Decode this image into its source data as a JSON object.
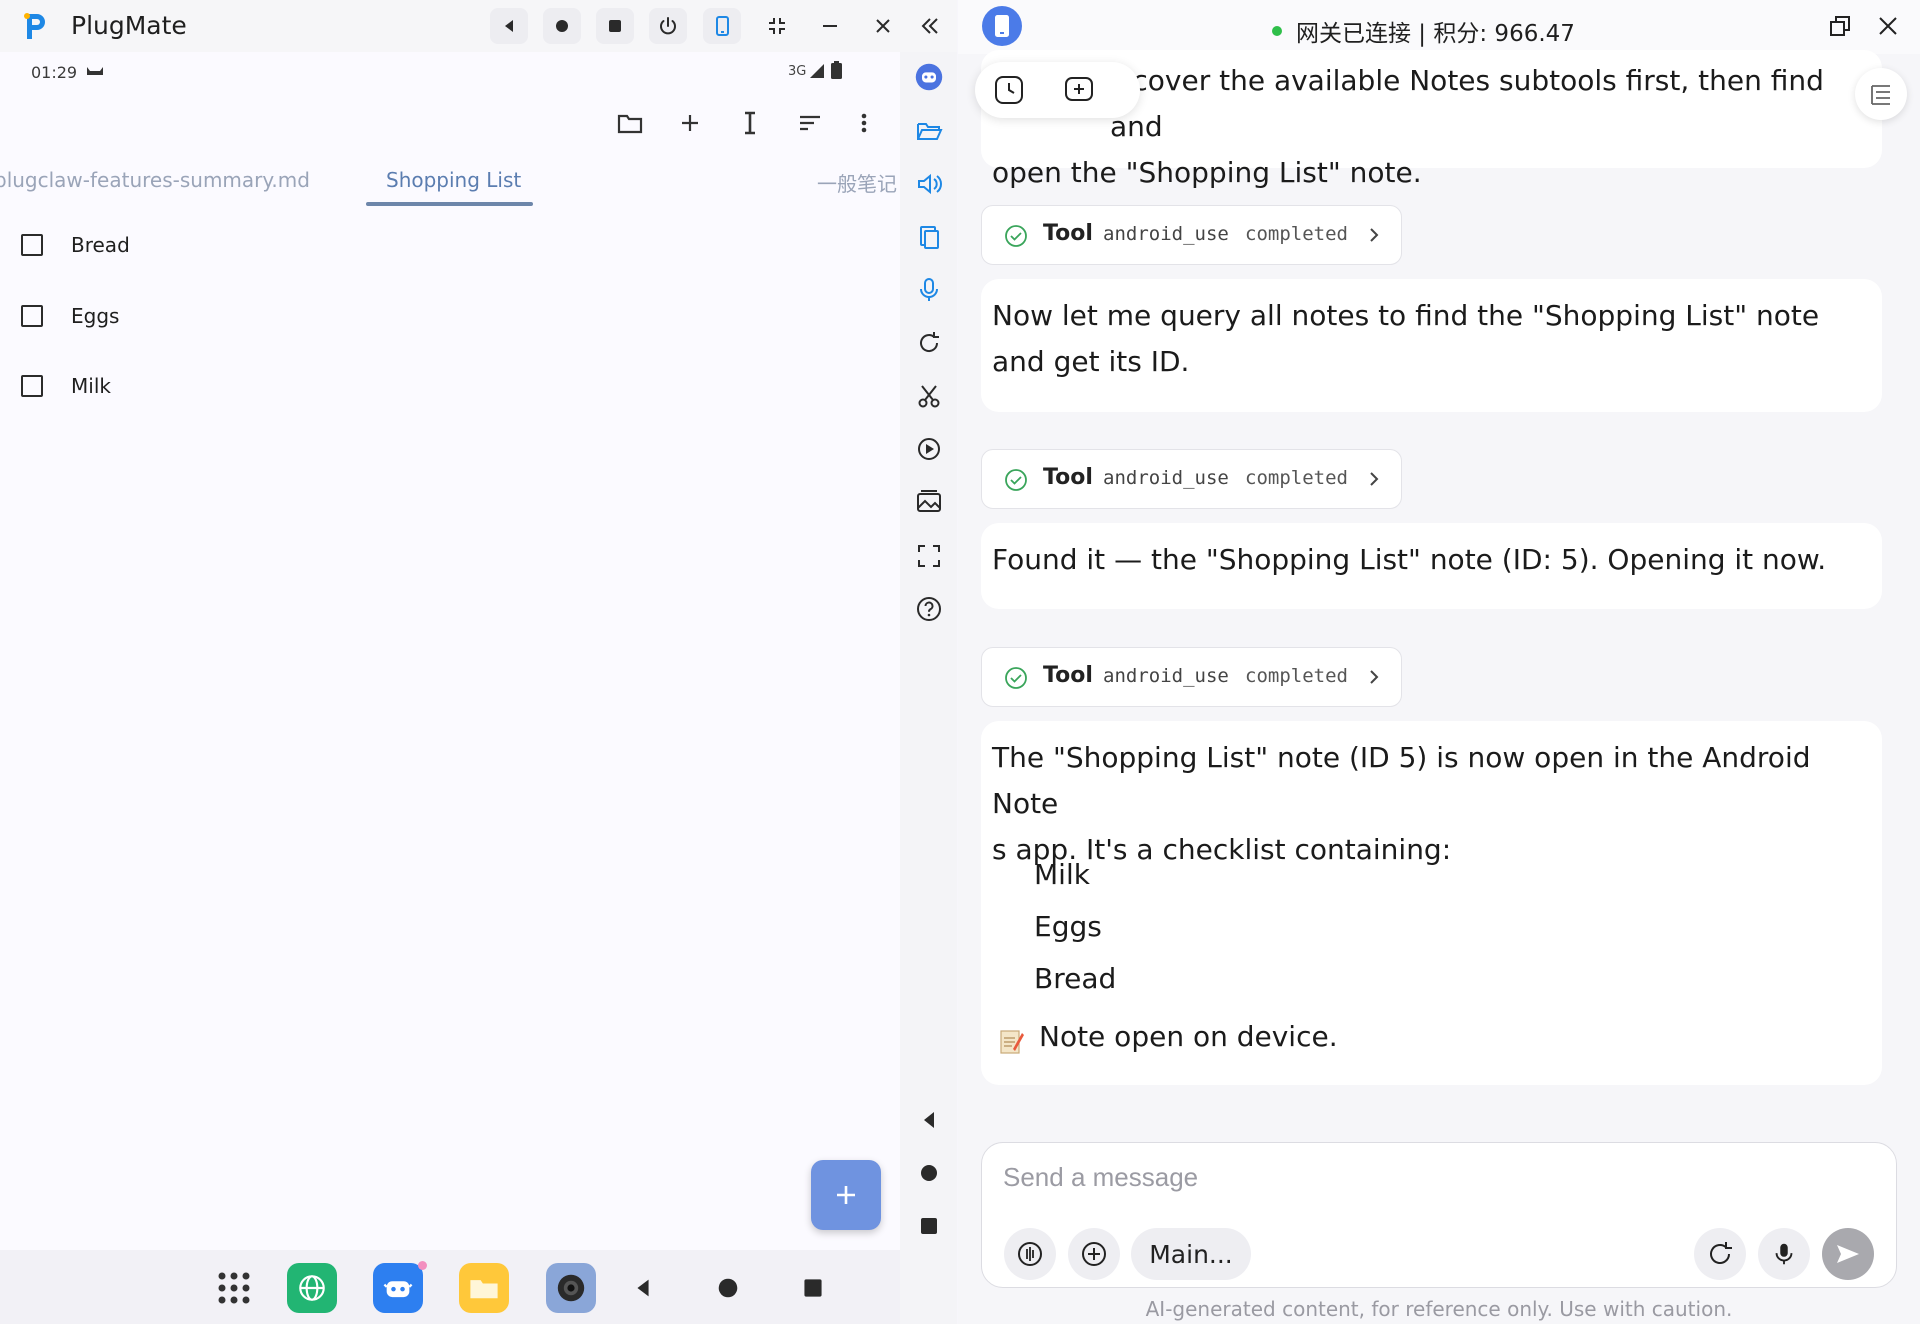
{
  "app": {
    "title": "PlugMate"
  },
  "android": {
    "status_time": "01:29",
    "network": "3G",
    "toolbar_icons": [
      "folder-icon",
      "plus-icon",
      "text-cursor-icon",
      "sort-icon",
      "more-vertical-icon"
    ],
    "tabs": [
      {
        "label": "plugclaw-features-summary.md",
        "active": false
      },
      {
        "label": "Shopping List",
        "active": true
      },
      {
        "label": "一般笔记",
        "active": false
      }
    ],
    "checklist": [
      {
        "label": "Bread",
        "checked": false
      },
      {
        "label": "Eggs",
        "checked": false
      },
      {
        "label": "Milk",
        "checked": false
      }
    ],
    "fab_icon": "plus-icon",
    "dock_apps": [
      "app-drawer-icon",
      "browser-icon",
      "robot-app-icon",
      "files-icon",
      "camera-icon"
    ]
  },
  "chat": {
    "status": "网关已连接 | 积分: 966.47",
    "status_color": "#2fbf4a",
    "messages": [
      {
        "type": "text",
        "text": "Let me discover the available Notes subtools first, then find and open the \"Shopping List\" note."
      },
      {
        "type": "tool",
        "label": "Tool",
        "name": "android_use",
        "status": "completed"
      },
      {
        "type": "text",
        "text": "Now let me query all notes to find the \"Shopping List\" note and get its ID."
      },
      {
        "type": "tool",
        "label": "Tool",
        "name": "android_use",
        "status": "completed"
      },
      {
        "type": "text",
        "text": "Found it — the \"Shopping List\" note (ID: 5). Opening it now."
      },
      {
        "type": "tool",
        "label": "Tool",
        "name": "android_use",
        "status": "completed"
      },
      {
        "type": "text",
        "text": "The \"Shopping List\" note (ID 5) is now open in the Android Notes app. It's a checklist containing:"
      }
    ],
    "visible_first_line_1": "iscover the available Notes subtools first, then find and",
    "visible_first_line_2": "open the \"Shopping List\" note.",
    "final_line_1": "The \"Shopping List\" note (ID 5) is now open in the Android Note",
    "final_line_2": "s app. It's a checklist containing:",
    "final_list": [
      "Milk",
      "Eggs",
      "Bread"
    ],
    "final_note": "Note open on device.",
    "composer_placeholder": "Send a message",
    "model_label": "Main...",
    "disclaimer": "AI-generated content, for reference only. Use with caution."
  }
}
